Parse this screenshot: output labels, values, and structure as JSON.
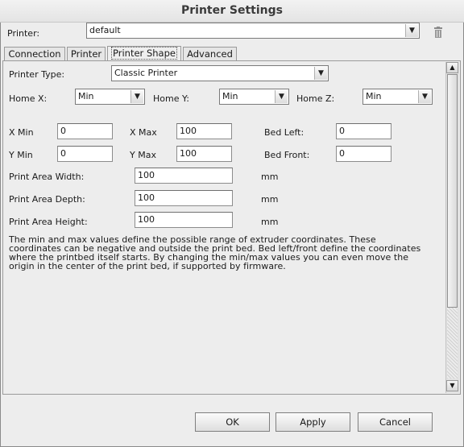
{
  "window": {
    "title": "Printer Settings"
  },
  "printer": {
    "label": "Printer:",
    "value": "default"
  },
  "tabs": [
    {
      "label": "Connection"
    },
    {
      "label": "Printer"
    },
    {
      "label": "Printer Shape"
    },
    {
      "label": "Advanced"
    }
  ],
  "shape": {
    "printer_type": {
      "label": "Printer Type:",
      "value": "Classic Printer"
    },
    "home_x": {
      "label": "Home X:",
      "value": "Min"
    },
    "home_y": {
      "label": "Home Y:",
      "value": "Min"
    },
    "home_z": {
      "label": "Home Z:",
      "value": "Min"
    },
    "x_min": {
      "label": "X Min",
      "value": "0"
    },
    "x_max": {
      "label": "X Max",
      "value": "100"
    },
    "bed_left": {
      "label": "Bed Left:",
      "value": "0"
    },
    "y_min": {
      "label": "Y Min",
      "value": "0"
    },
    "y_max": {
      "label": "Y Max",
      "value": "100"
    },
    "bed_front": {
      "label": "Bed Front:",
      "value": "0"
    },
    "width": {
      "label": "Print Area Width:",
      "value": "100",
      "unit": "mm"
    },
    "depth": {
      "label": "Print Area Depth:",
      "value": "100",
      "unit": "mm"
    },
    "height": {
      "label": "Print Area Height:",
      "value": "100",
      "unit": "mm"
    },
    "description_lines": [
      "The min and max values define the possible range of extruder coordinates. These",
      "coordinates can be negative and outside the print bed. Bed left/front define the coordinates",
      "where the printbed itself starts. By changing the min/max values you can even move the",
      "origin in the center of the print bed, if supported by firmware."
    ]
  },
  "buttons": {
    "ok": "OK",
    "apply": "Apply",
    "cancel": "Cancel"
  }
}
